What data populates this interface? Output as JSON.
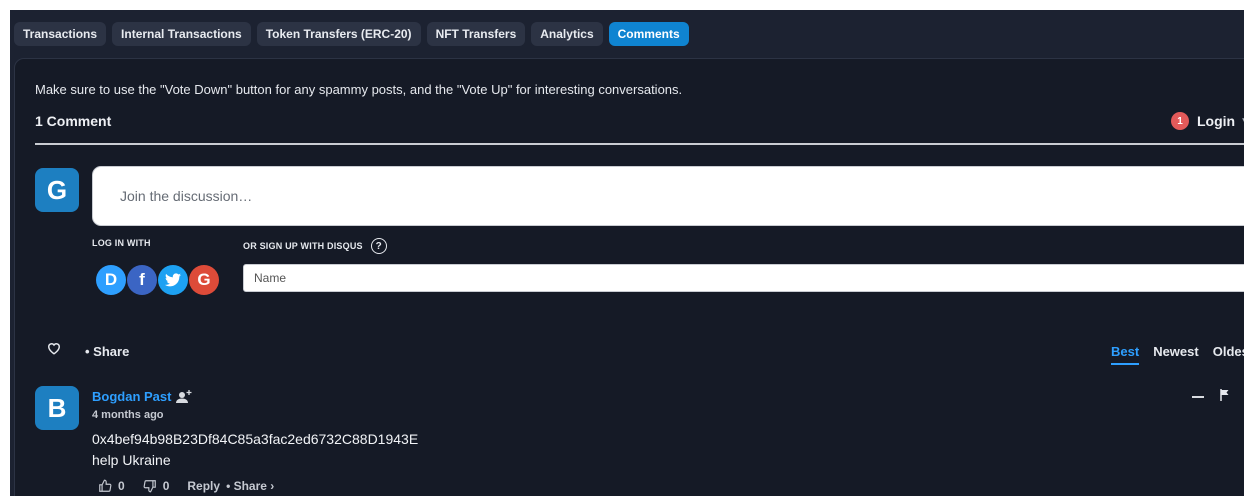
{
  "tabs": [
    {
      "label": "Transactions"
    },
    {
      "label": "Internal Transactions"
    },
    {
      "label": "Token Transfers (ERC-20)"
    },
    {
      "label": "NFT Transfers"
    },
    {
      "label": "Analytics"
    },
    {
      "label": "Comments",
      "active": true
    }
  ],
  "notice": "Make sure to use the \"Vote Down\" button for any spammy posts, and the \"Vote Up\" for interesting conversations.",
  "comment_count": "1 Comment",
  "login": {
    "badge": "1",
    "label": "Login"
  },
  "compose": {
    "avatar_letter": "G",
    "placeholder": "Join the discussion…"
  },
  "auth": {
    "login_with": "LOG IN WITH",
    "signup": "OR SIGN UP WITH DISQUS",
    "help": "?",
    "providers": [
      "D",
      "f",
      "G"
    ],
    "name_placeholder": "Name"
  },
  "toolbar": {
    "share": "• Share"
  },
  "sort": {
    "best": "Best",
    "newest": "Newest",
    "oldest": "Oldest"
  },
  "comment": {
    "avatar_letter": "B",
    "author": "Bogdan Past",
    "time": "4 months ago",
    "line1": "0x4bef94b98B23Df84C85a3fac2ed6732C88D1943E",
    "line2": "help Ukraine",
    "upvotes": "0",
    "downvotes": "0",
    "reply": "Reply",
    "share": "• Share ›"
  },
  "colors": {
    "accent": "#2e9fff",
    "active_tab": "#0f84d1",
    "panel": "#151a26",
    "badge": "#e35a5a"
  }
}
